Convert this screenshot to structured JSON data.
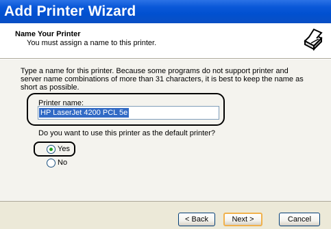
{
  "window": {
    "title": "Add Printer Wizard"
  },
  "header": {
    "title": "Name Your Printer",
    "subtitle": "You must assign a name to this printer.",
    "icon": "printer-icon"
  },
  "main": {
    "instructions": "Type a name for this printer. Because some programs do not support printer and server name combinations of more than 31 characters, it is best to keep the name as short as possible.",
    "printer_name_label": "Printer name:",
    "printer_name_value": "HP LaserJet 4200 PCL 5e",
    "default_question": "Do you want to use this printer as the default printer?",
    "options": [
      {
        "label": "Yes",
        "selected": true
      },
      {
        "label": "No",
        "selected": false
      }
    ]
  },
  "buttons": {
    "back": "< Back",
    "next": "Next >",
    "cancel": "Cancel"
  },
  "colors": {
    "title_bar": "#0050d0",
    "selection": "#316ac5",
    "radio_dot": "#21a121",
    "default_button_border": "#f1b14b"
  }
}
